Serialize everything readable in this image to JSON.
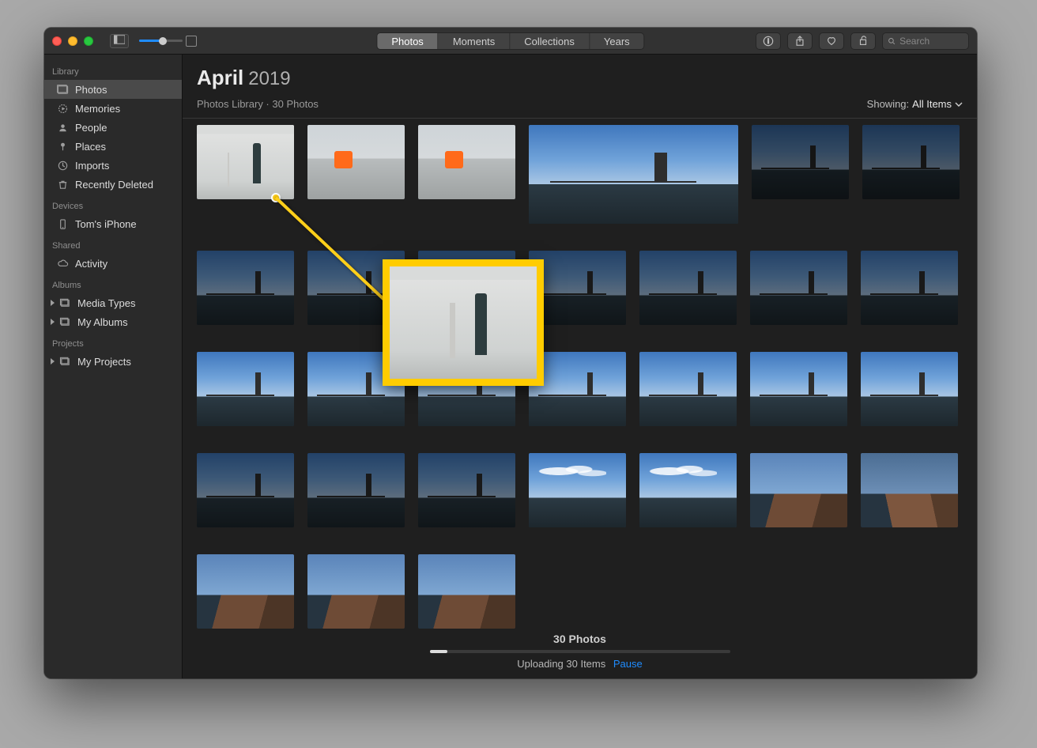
{
  "toolbar": {
    "tabs": [
      "Photos",
      "Moments",
      "Collections",
      "Years"
    ],
    "activeTab": 0,
    "search_placeholder": "Search"
  },
  "sidebar": {
    "sections": {
      "library": {
        "label": "Library",
        "items": [
          {
            "label": "Photos",
            "icon": "photos",
            "selected": true
          },
          {
            "label": "Memories",
            "icon": "memories"
          },
          {
            "label": "People",
            "icon": "people"
          },
          {
            "label": "Places",
            "icon": "places"
          },
          {
            "label": "Imports",
            "icon": "imports"
          },
          {
            "label": "Recently Deleted",
            "icon": "trash"
          }
        ]
      },
      "devices": {
        "label": "Devices",
        "items": [
          {
            "label": "Tom's iPhone",
            "icon": "iphone"
          }
        ]
      },
      "shared": {
        "label": "Shared",
        "items": [
          {
            "label": "Activity",
            "icon": "cloud"
          }
        ]
      },
      "albums": {
        "label": "Albums",
        "items": [
          {
            "label": "Media Types",
            "icon": "square",
            "disclosure": true
          },
          {
            "label": "My Albums",
            "icon": "square",
            "disclosure": true
          }
        ]
      },
      "projects": {
        "label": "Projects",
        "items": [
          {
            "label": "My Projects",
            "icon": "square",
            "disclosure": true
          }
        ]
      }
    }
  },
  "header": {
    "month": "April",
    "year": "2019",
    "breadcrumb": "Photos Library · 30 Photos",
    "showing_label": "Showing:",
    "showing_value": "All Items"
  },
  "footer": {
    "count_text": "30 Photos",
    "upload_text": "Uploading 30 Items",
    "pause_text": "Pause",
    "progress_pct": 6
  },
  "grid": {
    "rows": [
      [
        {
          "kind": "tent"
        },
        {
          "kind": "bench"
        },
        {
          "kind": "bench"
        },
        {
          "kind": "skyline-wide",
          "wide": true
        },
        {
          "kind": "skyline",
          "dim": "dark"
        },
        {
          "kind": "skyline",
          "dim": "dark"
        }
      ],
      [
        {
          "kind": "skyline",
          "dim": "shadowed"
        },
        {
          "kind": "skyline",
          "dim": "shadowed"
        },
        {
          "kind": "skyline",
          "dim": "shadowed"
        },
        {
          "kind": "skyline",
          "dim": "shadowed"
        },
        {
          "kind": "skyline",
          "dim": "shadowed"
        },
        {
          "kind": "skyline",
          "dim": "shadowed"
        },
        {
          "kind": "skyline",
          "dim": "shadowed"
        }
      ],
      [
        {
          "kind": "skyline"
        },
        {
          "kind": "skyline"
        },
        {
          "kind": "skyline"
        },
        {
          "kind": "skyline"
        },
        {
          "kind": "skyline"
        },
        {
          "kind": "skyline"
        },
        {
          "kind": "skyline"
        }
      ],
      [
        {
          "kind": "skyline",
          "dim": "shadowed"
        },
        {
          "kind": "skyline",
          "dim": "shadowed"
        },
        {
          "kind": "skyline",
          "dim": "shadowed"
        },
        {
          "kind": "skyline-b"
        },
        {
          "kind": "skyline-b"
        },
        {
          "kind": "building"
        },
        {
          "kind": "building2"
        }
      ],
      [
        {
          "kind": "building"
        },
        {
          "kind": "building"
        },
        {
          "kind": "building"
        }
      ]
    ]
  },
  "colors": {
    "annotation": "#ffcc00",
    "accent": "#1f8cff"
  }
}
